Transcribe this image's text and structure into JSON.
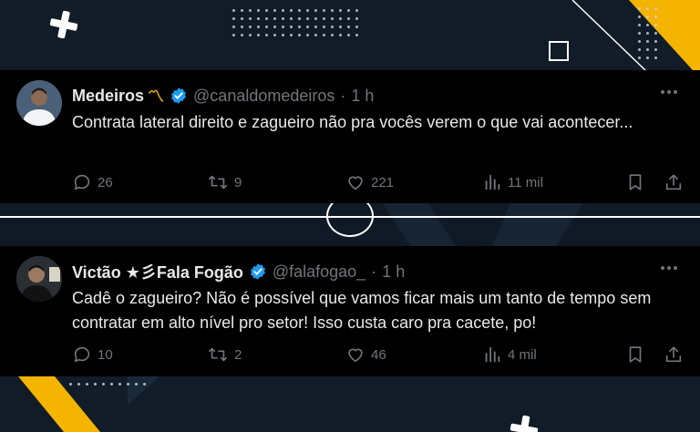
{
  "tweets": [
    {
      "name": "Medeiros",
      "name_emoji": "〽",
      "handle": "@canaldomedeiros",
      "separator": "·",
      "time": "1 h",
      "text": "Contrata lateral direito e zagueiro não pra vocês verem o que vai acontecer...",
      "replies": "26",
      "retweets": "9",
      "likes": "221",
      "views": "11 mil"
    },
    {
      "name": "Victão ★彡Fala Fogão",
      "handle": "@falafogao_",
      "separator": "·",
      "time": "1 h",
      "text": "Cadê o zagueiro? Não é possível que vamos ficar mais um tanto de tempo sem contratar em alto nível pro setor! Isso custa caro pra cacete, po!",
      "replies": "10",
      "retweets": "2",
      "likes": "46",
      "views": "4 mil"
    }
  ],
  "icons": {
    "reply": "speech-bubble-icon",
    "retweet": "retweet-icon",
    "like": "heart-icon",
    "views": "bar-chart-icon",
    "bookmark": "bookmark-icon",
    "share": "share-icon",
    "verified": "verified-badge-icon",
    "more": "more-dots-icon"
  },
  "colors": {
    "background": "#0f1722",
    "tweet_background": "#000000",
    "accent_yellow": "#f4b400",
    "verified_blue": "#1d9bf0",
    "muted_text": "#71767b",
    "main_text": "#e7e9ea"
  }
}
